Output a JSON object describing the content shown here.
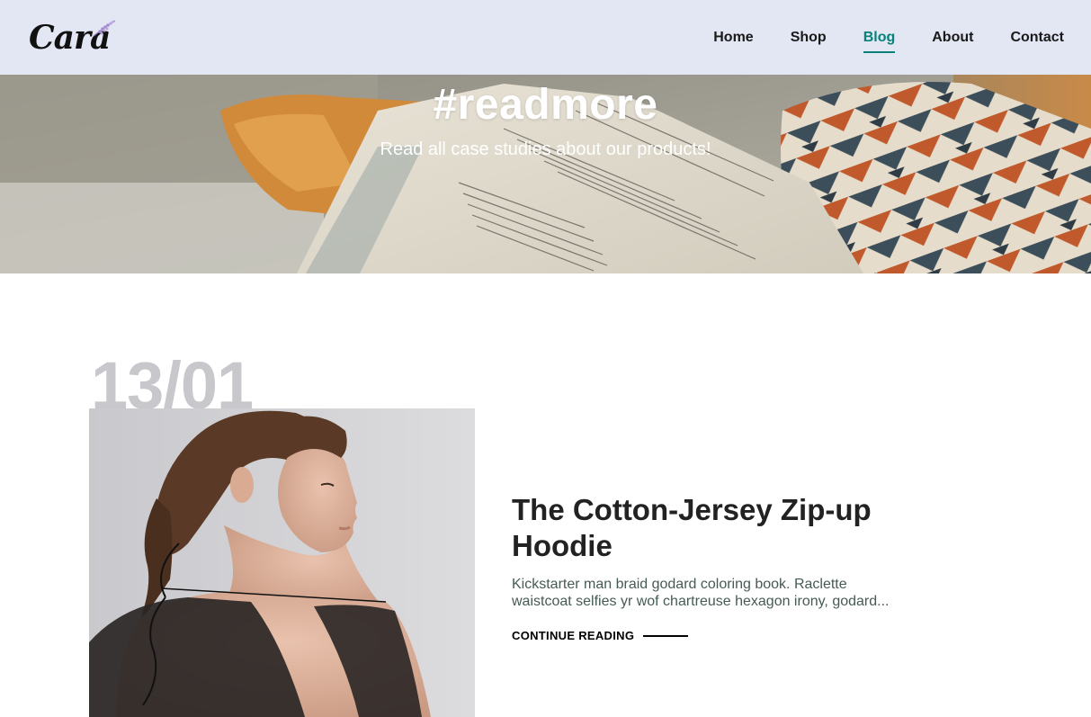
{
  "header": {
    "logo_text": "Cara",
    "nav": [
      {
        "label": "Home",
        "active": false
      },
      {
        "label": "Shop",
        "active": false
      },
      {
        "label": "Blog",
        "active": true
      },
      {
        "label": "About",
        "active": false
      },
      {
        "label": "Contact",
        "active": false
      }
    ]
  },
  "hero": {
    "title": "#readmore",
    "subtitle": "Read all case studies about our products!"
  },
  "post": {
    "date": "13/01",
    "title": "The Cotton-Jersey Zip-up Hoodie",
    "excerpt": "Kickstarter man braid godard coloring book. Raclette waistcoat selfies yr wof chartreuse hexagon irony, godard...",
    "cta": "CONTINUE READING"
  },
  "colors": {
    "header_bg": "#e3e6f3",
    "accent": "#088178",
    "date_text": "#c8c8cc",
    "excerpt_text": "#465b52"
  },
  "icons": {
    "logo_sprig": "lavender-sprig-icon"
  }
}
